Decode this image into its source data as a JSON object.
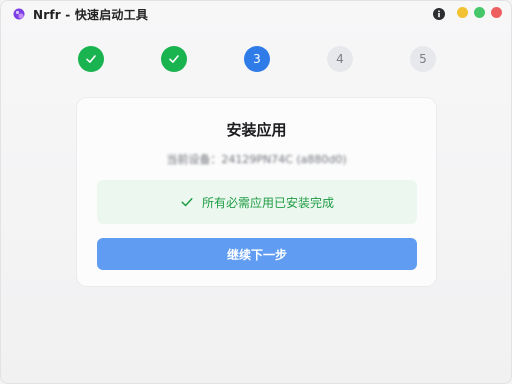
{
  "window": {
    "title": "Nrfr - 快速启动工具",
    "icons": [
      "app-logo-icon",
      "info-icon",
      "minimize-dot",
      "maximize-dot",
      "close-dot"
    ],
    "colors": {
      "close": "#ee5f61",
      "minimize": "#f2c233",
      "maximize": "#46c76a"
    }
  },
  "stepper": {
    "current_step": 3,
    "steps": [
      {
        "label": "",
        "status": "done"
      },
      {
        "label": "",
        "status": "done"
      },
      {
        "label": "3",
        "status": "active"
      },
      {
        "label": "4",
        "status": "pending"
      },
      {
        "label": "5",
        "status": "pending"
      }
    ],
    "colors": {
      "done": "#19b34f",
      "active": "#2f7be8",
      "pending": "#e7e8ec"
    }
  },
  "card": {
    "title": "安装应用",
    "device_line": "当前设备：24129PN74C (a880d0)",
    "success_message": "所有必需应用已安装完成",
    "success_color": "#1f9c45",
    "next_button_label": "继续下一步",
    "button_color": "#5f9cf2"
  }
}
